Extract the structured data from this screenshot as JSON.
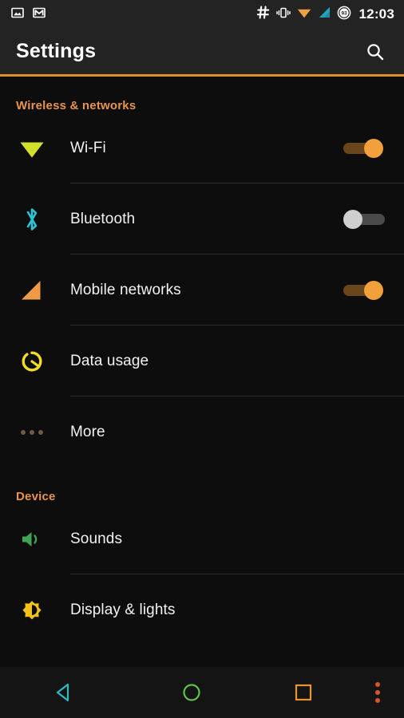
{
  "status_bar": {
    "left_icons": [
      {
        "name": "screenshot-icon",
        "glyph": "image"
      },
      {
        "name": "gmail-icon",
        "glyph": "mail"
      }
    ],
    "right_icons": [
      {
        "name": "hash-icon",
        "glyph": "#"
      },
      {
        "name": "vibrate-icon",
        "glyph": "vibrate"
      },
      {
        "name": "wifi-status-icon",
        "glyph": "wifi",
        "color": "#f0a044"
      },
      {
        "name": "cell-signal-icon",
        "glyph": "signal",
        "color": "#1fa6bd"
      },
      {
        "name": "battery-icon",
        "glyph": "battery-circle",
        "level": "93"
      }
    ],
    "battery_level": "93",
    "clock": "12:03"
  },
  "app_bar": {
    "title": "Settings",
    "search_label": "Search",
    "accent_color": "#e0902a"
  },
  "sections": [
    {
      "header": "Wireless & networks",
      "items": [
        {
          "label": "Wi-Fi",
          "icon": "wifi-icon",
          "icon_color": "#d2e029",
          "control": "switch",
          "state": "on"
        },
        {
          "label": "Bluetooth",
          "icon": "bluetooth-icon",
          "icon_color": "#29c3d4",
          "control": "switch",
          "state": "off"
        },
        {
          "label": "Mobile networks",
          "icon": "mobile-network-icon",
          "icon_color": "#ef9a46",
          "control": "switch",
          "state": "on"
        },
        {
          "label": "Data usage",
          "icon": "data-usage-icon",
          "icon_color": "#f2dc2a",
          "control": "none",
          "state": ""
        },
        {
          "label": "More",
          "icon": "more-icon",
          "icon_color": "#6e5a48",
          "control": "none",
          "state": ""
        }
      ]
    },
    {
      "header": "Device",
      "items": [
        {
          "label": "Sounds",
          "icon": "sound-icon",
          "icon_color": "#3fa552",
          "control": "none",
          "state": ""
        },
        {
          "label": "Display & lights",
          "icon": "display-icon",
          "icon_color": "#f2c21a",
          "control": "none",
          "state": ""
        }
      ]
    }
  ],
  "nav_bar": {
    "back_label": "Back",
    "home_label": "Home",
    "recents_label": "Recents",
    "menu_label": "Menu",
    "back_color": "#2eb8c4",
    "home_color": "#5cc24a",
    "recents_color": "#e8952a",
    "menu_color": "#d4562c"
  }
}
